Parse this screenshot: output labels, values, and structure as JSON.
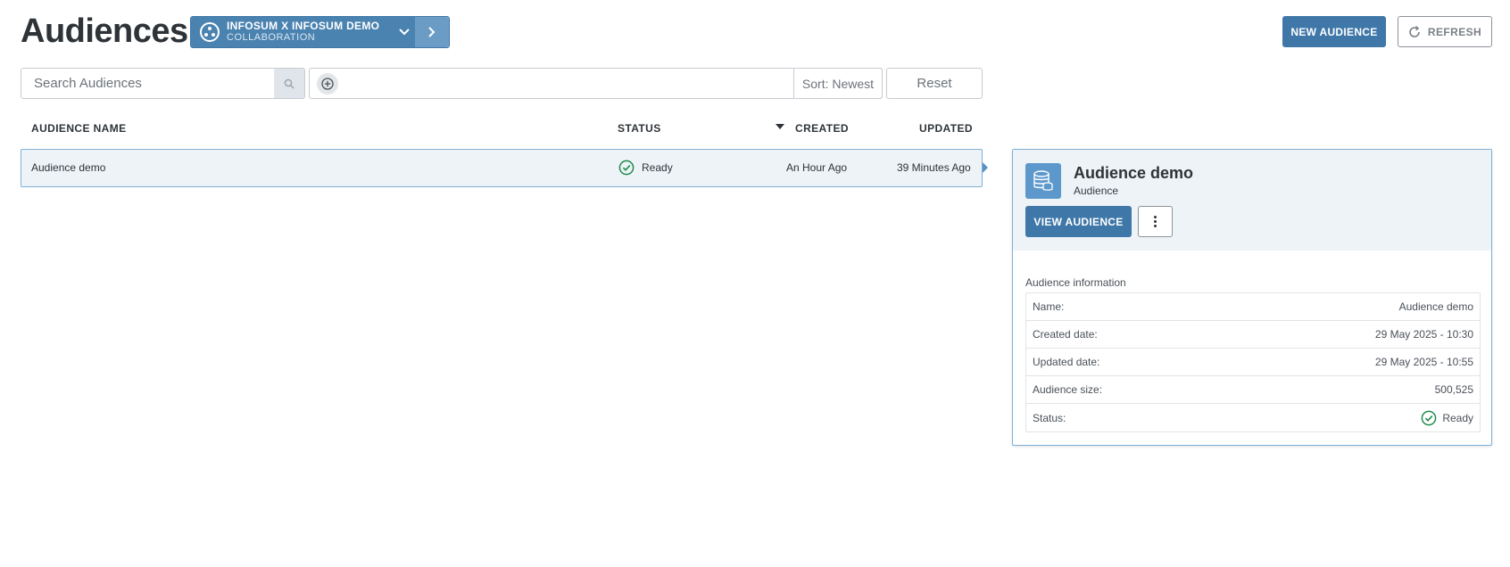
{
  "header": {
    "title": "Audiences",
    "collaboration": {
      "title": "INFOSUM X INFOSUM DEMO",
      "subtitle": "COLLABORATION",
      "icon": "collaboration-icon"
    },
    "new_audience_label": "NEW AUDIENCE",
    "refresh_label": "REFRESH"
  },
  "toolbar": {
    "search_placeholder": "Search Audiences",
    "sort_label": "Sort: Newest",
    "reset_label": "Reset"
  },
  "table": {
    "columns": {
      "name": "AUDIENCE NAME",
      "status": "STATUS",
      "created": "CREATED",
      "updated": "UPDATED"
    },
    "rows": [
      {
        "name": "Audience demo",
        "status": "Ready",
        "created": "An Hour Ago",
        "updated": "39 Minutes Ago"
      }
    ]
  },
  "detail": {
    "title": "Audience demo",
    "subtitle": "Audience",
    "view_label": "VIEW AUDIENCE",
    "section_label": "Audience information",
    "fields": [
      {
        "label": "Name:",
        "value": "Audience demo"
      },
      {
        "label": "Created date:",
        "value": "29 May 2025 - 10:30"
      },
      {
        "label": "Updated date:",
        "value": "29 May 2025 - 10:55"
      },
      {
        "label": "Audience size:",
        "value": "500,525"
      },
      {
        "label": "Status:",
        "value": "Ready"
      }
    ]
  },
  "colors": {
    "primary": "#3f78a8",
    "selected_row": "#edf3f7",
    "success": "#1f8a4c"
  }
}
